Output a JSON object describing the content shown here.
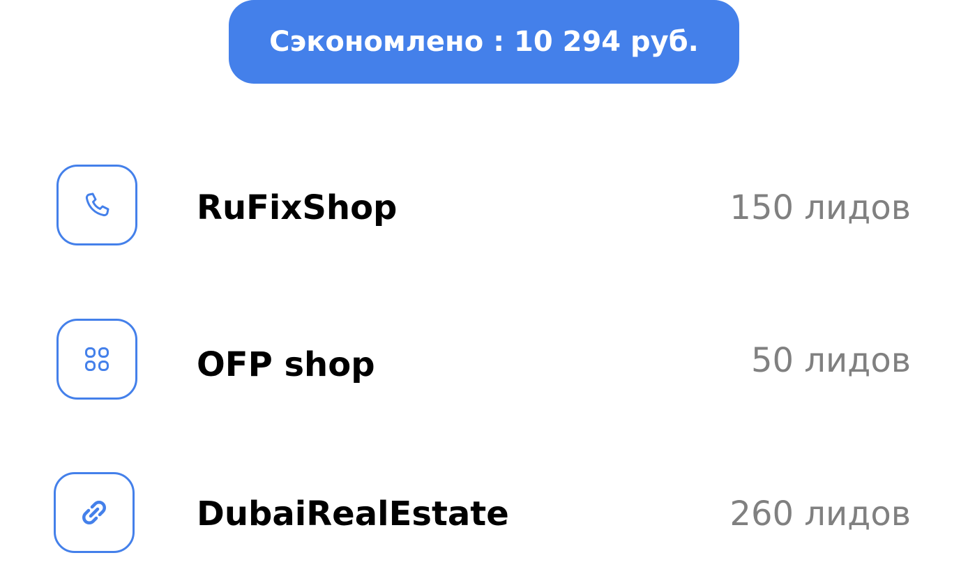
{
  "savings": {
    "text": "Сэкономлено : 10 294 руб."
  },
  "shops": [
    {
      "name": "RuFixShop",
      "leads": "150 лидов",
      "icon": "phone-icon"
    },
    {
      "name": "OFP shop",
      "leads": "50 лидов",
      "icon": "grid-icon"
    },
    {
      "name": "DubaiRealEstate",
      "leads": "260 лидов",
      "icon": "link-icon"
    }
  ],
  "colors": {
    "accent": "#4480ea",
    "primary_text": "#000000",
    "secondary_text": "#808080",
    "badge_text": "#ffffff"
  }
}
